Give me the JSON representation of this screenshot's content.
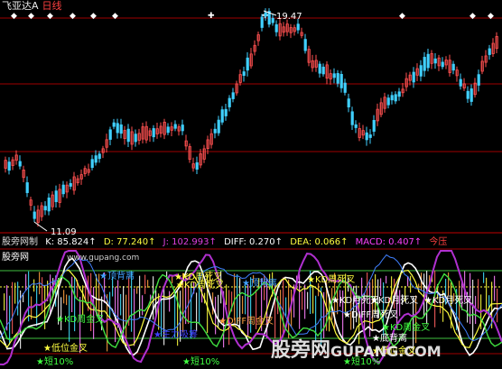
{
  "app": {
    "title": "飞亚达A",
    "timeframe": "日线"
  },
  "price_chart": {
    "high_label": "19.47",
    "low_label": "11.09"
  },
  "indicator_bar": {
    "name": "股旁网制",
    "k": "K: 85.824↑",
    "d": "D: 77.240↑",
    "j": "J: 102.993↑",
    "diff": "DIFF: 0.270↑",
    "dea": "DEA: 0.066↑",
    "macd": "MACD: 0.407↑",
    "today": "今压"
  },
  "site": {
    "label": "股旁网",
    "url": "www.gupang.com"
  },
  "signals": [
    {
      "text": "★顶背离",
      "color": "#40a0ff"
    },
    {
      "text": "★KD周死叉",
      "color": "#ffff40"
    },
    {
      "text": "★KD周死叉",
      "color": "#ffff40"
    },
    {
      "text": "★顶背离",
      "color": "#40a0ff"
    },
    {
      "text": "★KD周死叉",
      "color": "#ffff40"
    },
    {
      "text": "★KD月死叉",
      "color": "#ffffff"
    },
    {
      "text": "★KD月死叉",
      "color": "#ffffff"
    },
    {
      "text": "★KD月死叉",
      "color": "#ffffff"
    },
    {
      "text": "★KD周金叉",
      "color": "#40ff40"
    },
    {
      "text": "★KD周金叉",
      "color": "#40ff40"
    },
    {
      "text": "★低位金叉",
      "color": "#ffff40"
    },
    {
      "text": "★DIFF周金叉",
      "color": "#ffa040"
    },
    {
      "text": "★DIFF周死叉",
      "color": "#ffffff"
    },
    {
      "text": "★底背离",
      "color": "#ffffff"
    },
    {
      "text": "★短10%",
      "color": "#40ff40"
    },
    {
      "text": "★短10%",
      "color": "#40ff40"
    },
    {
      "text": "★短10%",
      "color": "#40ff40"
    },
    {
      "text": "★低位金叉",
      "color": "#ffff40"
    },
    {
      "text": "★主力吸筹",
      "color": "#4040ff"
    }
  ],
  "watermark": {
    "main": "股旁网",
    "sub": "GUPANG.COM"
  },
  "colors": {
    "up": "#ff5050",
    "down": "#40d0ff",
    "grid": "#a00000",
    "background": "#000000"
  }
}
